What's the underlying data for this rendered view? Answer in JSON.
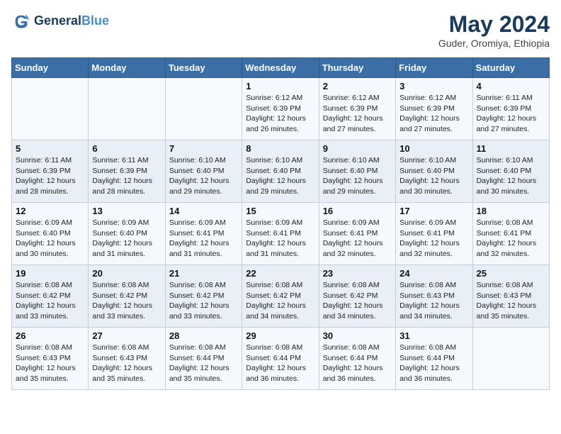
{
  "header": {
    "logo_line1": "General",
    "logo_line2": "Blue",
    "title": "May 2024",
    "subtitle": "Guder, Oromiya, Ethiopia"
  },
  "days_of_week": [
    "Sunday",
    "Monday",
    "Tuesday",
    "Wednesday",
    "Thursday",
    "Friday",
    "Saturday"
  ],
  "weeks": [
    [
      {
        "day": "",
        "info": ""
      },
      {
        "day": "",
        "info": ""
      },
      {
        "day": "",
        "info": ""
      },
      {
        "day": "1",
        "info": "Sunrise: 6:12 AM\nSunset: 6:39 PM\nDaylight: 12 hours\nand 26 minutes."
      },
      {
        "day": "2",
        "info": "Sunrise: 6:12 AM\nSunset: 6:39 PM\nDaylight: 12 hours\nand 27 minutes."
      },
      {
        "day": "3",
        "info": "Sunrise: 6:12 AM\nSunset: 6:39 PM\nDaylight: 12 hours\nand 27 minutes."
      },
      {
        "day": "4",
        "info": "Sunrise: 6:11 AM\nSunset: 6:39 PM\nDaylight: 12 hours\nand 27 minutes."
      }
    ],
    [
      {
        "day": "5",
        "info": "Sunrise: 6:11 AM\nSunset: 6:39 PM\nDaylight: 12 hours\nand 28 minutes."
      },
      {
        "day": "6",
        "info": "Sunrise: 6:11 AM\nSunset: 6:39 PM\nDaylight: 12 hours\nand 28 minutes."
      },
      {
        "day": "7",
        "info": "Sunrise: 6:10 AM\nSunset: 6:40 PM\nDaylight: 12 hours\nand 29 minutes."
      },
      {
        "day": "8",
        "info": "Sunrise: 6:10 AM\nSunset: 6:40 PM\nDaylight: 12 hours\nand 29 minutes."
      },
      {
        "day": "9",
        "info": "Sunrise: 6:10 AM\nSunset: 6:40 PM\nDaylight: 12 hours\nand 29 minutes."
      },
      {
        "day": "10",
        "info": "Sunrise: 6:10 AM\nSunset: 6:40 PM\nDaylight: 12 hours\nand 30 minutes."
      },
      {
        "day": "11",
        "info": "Sunrise: 6:10 AM\nSunset: 6:40 PM\nDaylight: 12 hours\nand 30 minutes."
      }
    ],
    [
      {
        "day": "12",
        "info": "Sunrise: 6:09 AM\nSunset: 6:40 PM\nDaylight: 12 hours\nand 30 minutes."
      },
      {
        "day": "13",
        "info": "Sunrise: 6:09 AM\nSunset: 6:40 PM\nDaylight: 12 hours\nand 31 minutes."
      },
      {
        "day": "14",
        "info": "Sunrise: 6:09 AM\nSunset: 6:41 PM\nDaylight: 12 hours\nand 31 minutes."
      },
      {
        "day": "15",
        "info": "Sunrise: 6:09 AM\nSunset: 6:41 PM\nDaylight: 12 hours\nand 31 minutes."
      },
      {
        "day": "16",
        "info": "Sunrise: 6:09 AM\nSunset: 6:41 PM\nDaylight: 12 hours\nand 32 minutes."
      },
      {
        "day": "17",
        "info": "Sunrise: 6:09 AM\nSunset: 6:41 PM\nDaylight: 12 hours\nand 32 minutes."
      },
      {
        "day": "18",
        "info": "Sunrise: 6:08 AM\nSunset: 6:41 PM\nDaylight: 12 hours\nand 32 minutes."
      }
    ],
    [
      {
        "day": "19",
        "info": "Sunrise: 6:08 AM\nSunset: 6:42 PM\nDaylight: 12 hours\nand 33 minutes."
      },
      {
        "day": "20",
        "info": "Sunrise: 6:08 AM\nSunset: 6:42 PM\nDaylight: 12 hours\nand 33 minutes."
      },
      {
        "day": "21",
        "info": "Sunrise: 6:08 AM\nSunset: 6:42 PM\nDaylight: 12 hours\nand 33 minutes."
      },
      {
        "day": "22",
        "info": "Sunrise: 6:08 AM\nSunset: 6:42 PM\nDaylight: 12 hours\nand 34 minutes."
      },
      {
        "day": "23",
        "info": "Sunrise: 6:08 AM\nSunset: 6:42 PM\nDaylight: 12 hours\nand 34 minutes."
      },
      {
        "day": "24",
        "info": "Sunrise: 6:08 AM\nSunset: 6:43 PM\nDaylight: 12 hours\nand 34 minutes."
      },
      {
        "day": "25",
        "info": "Sunrise: 6:08 AM\nSunset: 6:43 PM\nDaylight: 12 hours\nand 35 minutes."
      }
    ],
    [
      {
        "day": "26",
        "info": "Sunrise: 6:08 AM\nSunset: 6:43 PM\nDaylight: 12 hours\nand 35 minutes."
      },
      {
        "day": "27",
        "info": "Sunrise: 6:08 AM\nSunset: 6:43 PM\nDaylight: 12 hours\nand 35 minutes."
      },
      {
        "day": "28",
        "info": "Sunrise: 6:08 AM\nSunset: 6:44 PM\nDaylight: 12 hours\nand 35 minutes."
      },
      {
        "day": "29",
        "info": "Sunrise: 6:08 AM\nSunset: 6:44 PM\nDaylight: 12 hours\nand 36 minutes."
      },
      {
        "day": "30",
        "info": "Sunrise: 6:08 AM\nSunset: 6:44 PM\nDaylight: 12 hours\nand 36 minutes."
      },
      {
        "day": "31",
        "info": "Sunrise: 6:08 AM\nSunset: 6:44 PM\nDaylight: 12 hours\nand 36 minutes."
      },
      {
        "day": "",
        "info": ""
      }
    ]
  ]
}
